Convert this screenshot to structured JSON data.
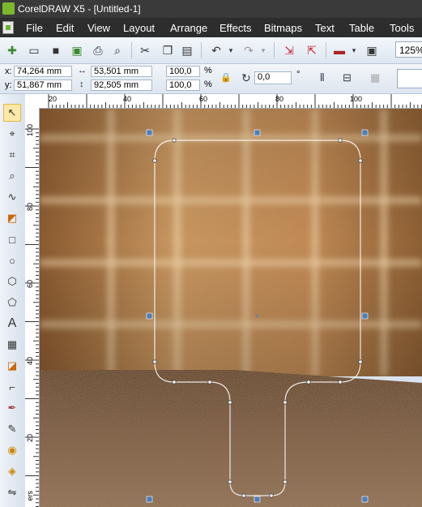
{
  "window": {
    "title": "CorelDRAW X5 - [Untitled-1]"
  },
  "menu": [
    "File",
    "Edit",
    "View",
    "Layout",
    "Arrange",
    "Effects",
    "Bitmaps",
    "Text",
    "Table",
    "Tools"
  ],
  "toolbar": {
    "icons": [
      "new-icon",
      "open-icon",
      "save-icon",
      "publish-icon",
      "print-icon",
      "print-preview-icon",
      "cut-icon",
      "copy-icon",
      "paste-icon",
      "undo-icon",
      "redo-icon",
      "import-icon",
      "export-icon",
      "application-launcher-icon",
      "welcome-screen-icon"
    ],
    "zoom": "125%"
  },
  "property_bar": {
    "x_label": "x:",
    "x_value": "74,264 mm",
    "y_label": "y:",
    "y_value": "51,867 mm",
    "width_value": "53,501 mm",
    "height_value": "92,505 mm",
    "scale_x": "100,0",
    "scale_y": "100,0",
    "percent_symbol": "%",
    "rotation_value": "0,0",
    "degree_symbol": "°"
  },
  "ruler": {
    "top_labels": [
      "20",
      "40",
      "60",
      "80",
      "100"
    ],
    "left_labels": [
      "100",
      "80",
      "60",
      "40",
      "20"
    ],
    "unit_label": "ers"
  },
  "toolbox": [
    "pick-tool-icon",
    "shape-tool-icon",
    "crop-tool-icon",
    "zoom-tool-icon",
    "freehand-tool-icon",
    "smart-fill-tool-icon",
    "rectangle-tool-icon",
    "ellipse-tool-icon",
    "polygon-tool-icon",
    "basic-shapes-tool-icon",
    "text-tool-icon",
    "table-tool-icon",
    "parallel-dimension-tool-icon",
    "connector-tool-icon",
    "eyedropper-tool-icon",
    "outline-pen-tool-icon",
    "fill-tool-icon",
    "interactive-fill-tool-icon",
    "blend-tool-icon"
  ],
  "colors": {
    "selection": "#4d7fb8",
    "wall": "#b8864f",
    "floor": "#7a5a3f"
  }
}
